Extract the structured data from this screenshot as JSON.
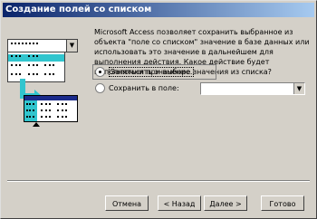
{
  "window": {
    "title": "Создание полей со списком"
  },
  "description": "Microsoft Access позволяет сохранить выбранное из объекта \"поле со списком\" значение в базе данных или использовать это значение в дальнейшем для выполнения действия.  Какое действие будет выполняться при выборе значения из списка?",
  "options": [
    {
      "label": "Запомнить значение.",
      "selected": true
    },
    {
      "label": "Сохранить в поле:",
      "selected": false
    }
  ],
  "field_select": {
    "value": ""
  },
  "buttons": {
    "cancel": "Отмена",
    "back": "< Назад",
    "next": "Далее >",
    "finish": "Готово"
  }
}
